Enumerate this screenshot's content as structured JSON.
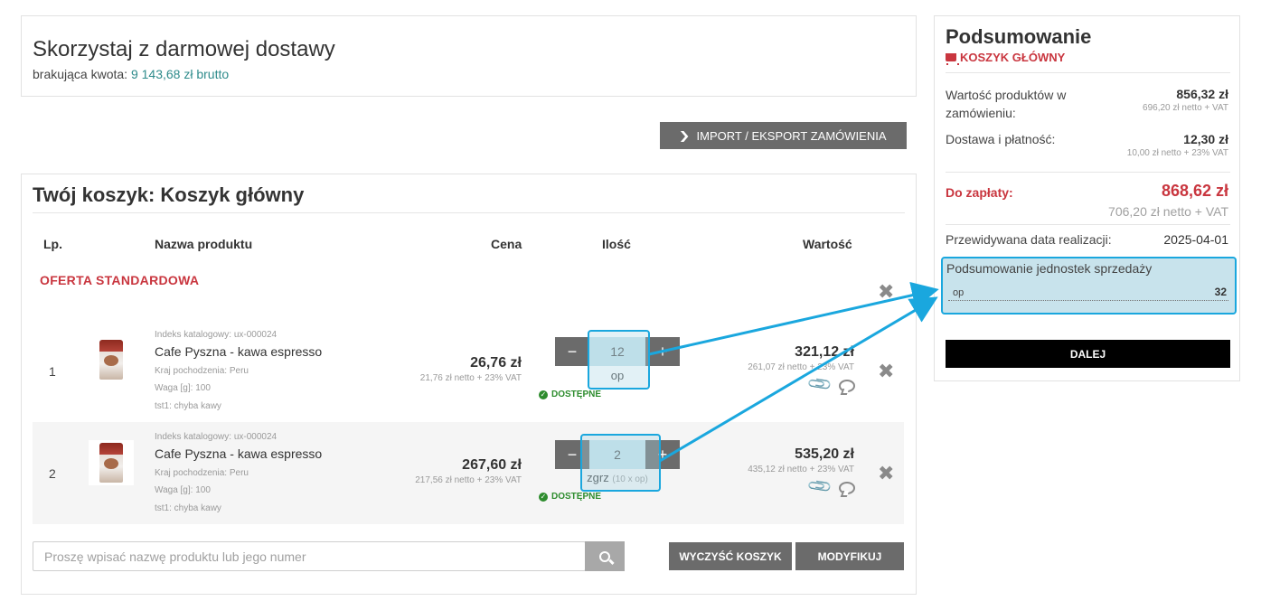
{
  "free_delivery": {
    "title": "Skorzystaj z darmowej dostawy",
    "missing_label": "brakująca kwota:",
    "missing_amount": "9 143,68 zł brutto"
  },
  "import_export": {
    "label": "IMPORT / EKSPORT ZAMÓWIENIA",
    "icon": "chevron-down-icon"
  },
  "cart": {
    "title": "Twój koszyk: Koszyk główny",
    "headers": {
      "lp": "Lp.",
      "name": "Nazwa produktu",
      "price": "Cena",
      "qty": "Ilość",
      "value": "Wartość"
    },
    "offer_label": "OFERTA STANDARDOWA",
    "items": [
      {
        "lp": "1",
        "catalog": "Indeks katalogowy: ux-000024",
        "name": "Cafe Pyszna - kawa espresso",
        "origin": "Kraj pochodzenia: Peru",
        "weight": "Waga [g]: 100",
        "tst": "tst1: chyba kawy",
        "price": "26,76 zł",
        "price_net": "21,76 zł netto + 23% VAT",
        "qty": "12",
        "unit": "op",
        "unit_mult": "",
        "availability": "DOSTĘPNE",
        "value": "321,12 zł",
        "value_net": "261,07 zł netto + 23% VAT"
      },
      {
        "lp": "2",
        "catalog": "Indeks katalogowy: ux-000024",
        "name": "Cafe Pyszna - kawa espresso",
        "origin": "Kraj pochodzenia: Peru",
        "weight": "Waga [g]: 100",
        "tst": "tst1: chyba kawy",
        "price": "267,60 zł",
        "price_net": "217,56 zł netto + 23% VAT",
        "qty": "2",
        "unit": "zgrz",
        "unit_mult": "(10 x op)",
        "availability": "DOSTĘPNE",
        "value": "535,20 zł",
        "value_net": "435,12 zł netto + 23% VAT"
      }
    ],
    "search_placeholder": "Proszę wpisać nazwę produktu lub jego numer",
    "clear_label": "WYCZYŚĆ KOSZYK",
    "modify_label": "MODYFIKUJ",
    "minus": "−",
    "plus": "+"
  },
  "summary": {
    "title": "Podsumowanie",
    "cart_name": "KOSZYK GŁÓWNY",
    "products_label": "Wartość produktów w zamówieniu:",
    "products_value": "856,32 zł",
    "products_net": "696,20 zł netto + VAT",
    "delivery_label": "Dostawa i płatność:",
    "delivery_value": "12,30 zł",
    "delivery_net": "10,00 zł netto + 23% VAT",
    "pay_label": "Do zapłaty:",
    "pay_value": "868,62 zł",
    "pay_net": "706,20 zł netto + VAT",
    "date_label": "Przewidywana data realizacji:",
    "date_value": "2025-04-01",
    "units_title": "Podsumowanie jednostek sprzedaży",
    "units_name": "op",
    "units_value": "32",
    "next_label": "DALEJ"
  },
  "colors": {
    "accent_red": "#c9363f",
    "highlight_blue": "#1aa7de",
    "teal": "#2e8b8b",
    "button_gray": "#6b6b6b"
  }
}
